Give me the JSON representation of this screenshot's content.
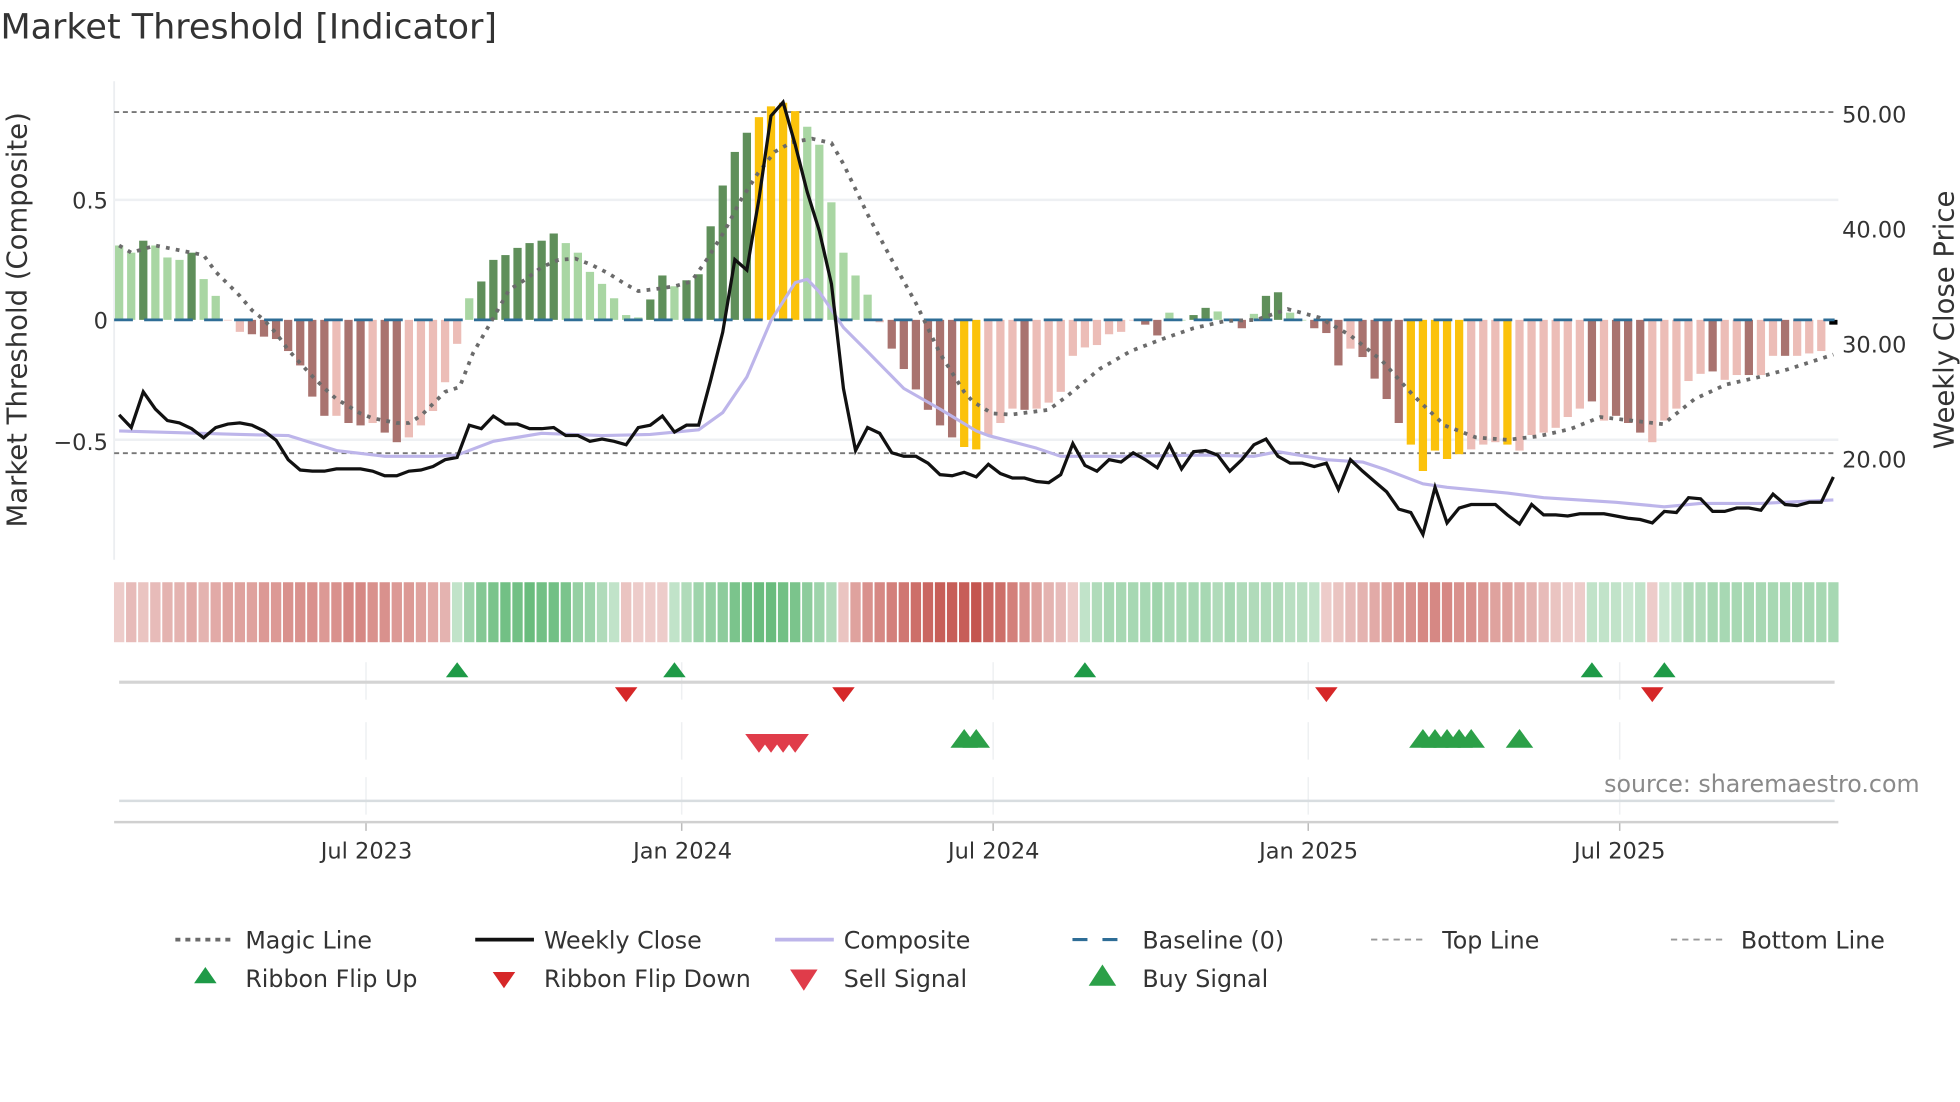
{
  "chart_data": {
    "type": "bar",
    "title": "Market Threshold [Indicator]",
    "ylabel_left": "Market Threshold (Composite)",
    "ylabel_right": "Weekly Close Price",
    "source": "source: sharemaestro.com",
    "x_unit": "week index (weekly bars)",
    "x_range": [
      0,
      142
    ],
    "ylim_left": [
      -0.98,
      1.0
    ],
    "ylim_right": [
      10.6,
      53.0
    ],
    "grid": true,
    "legend_position": "bottom",
    "left_ticks": [
      {
        "v": 0.5,
        "label": "0.5"
      },
      {
        "v": 0,
        "label": "0"
      },
      {
        "v": -0.5,
        "label": "−0.5"
      }
    ],
    "right_ticks": [
      {
        "v": 50,
        "label": "50.00"
      },
      {
        "v": 40,
        "label": "40.00"
      },
      {
        "v": 30,
        "label": "30.00"
      },
      {
        "v": 20,
        "label": "20.00"
      }
    ],
    "x_ticks": [
      {
        "v": 20.45,
        "label": "Jul 2023"
      },
      {
        "v": 46.6,
        "label": "Jan 2024"
      },
      {
        "v": 72.4,
        "label": "Jul 2024"
      },
      {
        "v": 98.5,
        "label": "Jan 2025"
      },
      {
        "v": 124.3,
        "label": "Jul 2025"
      }
    ],
    "top_line": 0.866,
    "bottom_line": -0.556,
    "baseline": 0,
    "colors": {
      "L": "#a9d6a3",
      "G": "#5f8f5a",
      "Y": "#fbc20b",
      "P": "#ecbdb7",
      "R": "#a9736f",
      "magic": "#6b6b6b",
      "close": "#111111",
      "composite": "#bdb5ea",
      "baseline": "#2e6d96",
      "flip_up": "#1e9a47",
      "flip_down": "#d62728",
      "sell": "#e03c4a",
      "buy": "#2ca048",
      "ribbon_red": "#c4554f",
      "ribbon_green": "#4fb066"
    },
    "composite_bars": {
      "values": [
        0.31,
        0.28,
        0.33,
        0.31,
        0.26,
        0.25,
        0.28,
        0.17,
        0.1,
        0,
        -0.05,
        -0.06,
        -0.07,
        -0.08,
        -0.13,
        -0.19,
        -0.32,
        -0.4,
        -0.4,
        -0.43,
        -0.44,
        -0.43,
        -0.47,
        -0.51,
        -0.49,
        -0.44,
        -0.38,
        -0.26,
        -0.1,
        0.09,
        0.16,
        0.25,
        0.27,
        0.3,
        0.32,
        0.33,
        0.36,
        0.32,
        0.28,
        0.2,
        0.15,
        0.09,
        0.02,
        0.01,
        0.085,
        0.185,
        0.14,
        0.165,
        0.19,
        0.39,
        0.56,
        0.7,
        0.78,
        0.845,
        0.89,
        0.905,
        0.87,
        0.805,
        0.73,
        0.49,
        0.28,
        0.185,
        0.105,
        -0.01,
        -0.12,
        -0.205,
        -0.29,
        -0.375,
        -0.44,
        -0.49,
        -0.53,
        -0.54,
        -0.48,
        -0.43,
        -0.37,
        -0.375,
        -0.37,
        -0.345,
        -0.3,
        -0.15,
        -0.115,
        -0.105,
        -0.06,
        -0.05,
        0,
        -0.02,
        -0.065,
        0.03,
        0,
        0.02,
        0.05,
        0.035,
        0,
        -0.035,
        0.025,
        0.1,
        0.115,
        0.03,
        0,
        -0.035,
        -0.055,
        -0.19,
        -0.12,
        -0.155,
        -0.245,
        -0.33,
        -0.43,
        -0.52,
        -0.63,
        -0.545,
        -0.58,
        -0.56,
        -0.54,
        -0.52,
        -0.51,
        -0.52,
        -0.545,
        -0.48,
        -0.47,
        -0.45,
        -0.405,
        -0.37,
        -0.34,
        -0.42,
        -0.4,
        -0.43,
        -0.47,
        -0.51,
        -0.42,
        -0.37,
        -0.255,
        -0.225,
        -0.215,
        -0.25,
        -0.23,
        -0.23,
        -0.23,
        -0.15,
        -0.15,
        -0.15,
        -0.14,
        -0.13,
        -0.02
      ],
      "color_codes": "LLGLLLGLLPPRRRRRRRPRRPRRPPPPPLGGGGGGGLLLLLLLGGLGGGGGGYYYYLLLLLLPRRRRRRYYPPPRPPPPPPPPPRRLLGGLLRLGGLLRRRPRRRRYYYYYPPPYPPPPPPRPRRRPPPPPRPPRPPRPPP"
    },
    "weekly_close": [
      23.8,
      22.7,
      25.8,
      24.3,
      23.3,
      23.1,
      22.6,
      21.8,
      22.7,
      23.0,
      23.1,
      22.9,
      22.4,
      21.6,
      19.9,
      19.0,
      18.9,
      18.9,
      19.1,
      19.1,
      19.1,
      18.9,
      18.5,
      18.5,
      18.9,
      19.0,
      19.3,
      19.9,
      20.1,
      22.9,
      22.6,
      23.7,
      23.0,
      23.0,
      22.6,
      22.6,
      22.7,
      22.0,
      22.0,
      21.5,
      21.7,
      21.5,
      21.2,
      22.7,
      22.9,
      23.7,
      22.3,
      22.9,
      22.9,
      26.8,
      31.0,
      37.3,
      36.4,
      42.6,
      49.8,
      51.0,
      47.3,
      43.2,
      39.8,
      35.2,
      26.1,
      20.7,
      22.7,
      22.2,
      20.5,
      20.2,
      20.2,
      19.6,
      18.6,
      18.5,
      18.8,
      18.4,
      19.5,
      18.7,
      18.3,
      18.3,
      18.0,
      17.9,
      18.6,
      21.3,
      19.4,
      18.9,
      19.9,
      19.7,
      20.5,
      19.9,
      19.2,
      21.2,
      19.1,
      20.6,
      20.7,
      20.3,
      18.9,
      19.9,
      21.2,
      21.7,
      20.2,
      19.6,
      19.6,
      19.3,
      19.6,
      17.3,
      19.9,
      18.9,
      18.0,
      17.1,
      15.6,
      15.3,
      13.4,
      17.5,
      14.4,
      15.7,
      16.0,
      16.0,
      16.0,
      15.1,
      14.3,
      16.0,
      15.1,
      15.1,
      15.0,
      15.2,
      15.2,
      15.2,
      15.0,
      14.8,
      14.7,
      14.4,
      15.4,
      15.3,
      16.6,
      16.5,
      15.4,
      15.4,
      15.7,
      15.7,
      15.5,
      16.9,
      16.0,
      15.9,
      16.2,
      16.2,
      18.4
    ],
    "composite_line": [
      [
        0,
        22.4
      ],
      [
        10,
        22.1
      ],
      [
        14,
        22.0
      ],
      [
        18,
        20.7
      ],
      [
        22,
        20.2
      ],
      [
        26,
        20.2
      ],
      [
        28,
        20.3
      ],
      [
        31,
        21.5
      ],
      [
        35,
        22.2
      ],
      [
        40,
        22.0
      ],
      [
        44,
        22.1
      ],
      [
        48,
        22.5
      ],
      [
        50,
        24.0
      ],
      [
        52,
        27.1
      ],
      [
        54,
        32.0
      ],
      [
        56,
        35.3
      ],
      [
        57,
        35.6
      ],
      [
        58,
        34.5
      ],
      [
        60,
        31.4
      ],
      [
        62,
        29.3
      ],
      [
        65,
        26.1
      ],
      [
        68,
        24.3
      ],
      [
        71,
        22.4
      ],
      [
        72,
        22.0
      ],
      [
        76,
        20.9
      ],
      [
        78,
        20.2
      ],
      [
        84,
        20.2
      ],
      [
        90,
        20.3
      ],
      [
        94,
        20.2
      ],
      [
        96,
        20.6
      ],
      [
        100,
        19.9
      ],
      [
        103,
        19.7
      ],
      [
        105,
        19.0
      ],
      [
        108,
        17.8
      ],
      [
        110,
        17.5
      ],
      [
        115,
        17.0
      ],
      [
        118,
        16.6
      ],
      [
        124,
        16.2
      ],
      [
        128,
        15.8
      ],
      [
        131,
        16.1
      ],
      [
        136,
        16.1
      ],
      [
        142,
        16.4
      ]
    ],
    "magic_line": [
      [
        0,
        0.31
      ],
      [
        1,
        0.28
      ],
      [
        3,
        0.31
      ],
      [
        5,
        0.29
      ],
      [
        7,
        0.27
      ],
      [
        8,
        0.2
      ],
      [
        9,
        0.15
      ],
      [
        10,
        0.1
      ],
      [
        11,
        0.04
      ],
      [
        12,
        0
      ],
      [
        13,
        -0.055
      ],
      [
        14,
        -0.125
      ],
      [
        15,
        -0.18
      ],
      [
        16,
        -0.235
      ],
      [
        17,
        -0.285
      ],
      [
        18,
        -0.33
      ],
      [
        19,
        -0.36
      ],
      [
        20,
        -0.39
      ],
      [
        21,
        -0.41
      ],
      [
        22,
        -0.42
      ],
      [
        23,
        -0.43
      ],
      [
        24,
        -0.43
      ],
      [
        25,
        -0.4
      ],
      [
        26,
        -0.35
      ],
      [
        27,
        -0.3
      ],
      [
        28.2,
        -0.28
      ],
      [
        29.3,
        -0.14
      ],
      [
        30.9,
        0
      ],
      [
        32.3,
        0.125
      ],
      [
        33.7,
        0.17
      ],
      [
        35,
        0.22
      ],
      [
        36.4,
        0.25
      ],
      [
        37.8,
        0.255
      ],
      [
        39.1,
        0.23
      ],
      [
        40.5,
        0.195
      ],
      [
        41.9,
        0.15
      ],
      [
        43,
        0.12
      ],
      [
        44.7,
        0.13
      ],
      [
        46,
        0.14
      ],
      [
        47.4,
        0.16
      ],
      [
        48.8,
        0.26
      ],
      [
        50.2,
        0.375
      ],
      [
        51.5,
        0.5
      ],
      [
        52.9,
        0.61
      ],
      [
        54.3,
        0.7
      ],
      [
        55.7,
        0.74
      ],
      [
        57.4,
        0.755
      ],
      [
        59,
        0.737
      ],
      [
        60,
        0.65
      ],
      [
        62,
        0.44
      ],
      [
        64,
        0.25
      ],
      [
        66,
        0.07
      ],
      [
        68,
        -0.14
      ],
      [
        70,
        -0.3
      ],
      [
        70.7,
        -0.34
      ],
      [
        72.3,
        -0.39
      ],
      [
        73.9,
        -0.395
      ],
      [
        77,
        -0.375
      ],
      [
        78.6,
        -0.315
      ],
      [
        81.2,
        -0.205
      ],
      [
        83.8,
        -0.13
      ],
      [
        86.4,
        -0.08
      ],
      [
        89,
        -0.035
      ],
      [
        91.6,
        -0.005
      ],
      [
        94.2,
        0
      ],
      [
        96.8,
        0.045
      ],
      [
        99.4,
        0.01
      ],
      [
        102,
        -0.065
      ],
      [
        104.6,
        -0.17
      ],
      [
        107.2,
        -0.315
      ],
      [
        109.8,
        -0.44
      ],
      [
        112.4,
        -0.49
      ],
      [
        115,
        -0.5
      ],
      [
        117.6,
        -0.485
      ],
      [
        120.2,
        -0.455
      ],
      [
        122.7,
        -0.405
      ],
      [
        125.3,
        -0.42
      ],
      [
        127.9,
        -0.435
      ],
      [
        130.5,
        -0.33
      ],
      [
        133.1,
        -0.27
      ],
      [
        135.7,
        -0.24
      ],
      [
        138.3,
        -0.205
      ],
      [
        142,
        -0.145
      ]
    ],
    "ribbon": [
      -0.15,
      -0.25,
      -0.2,
      -0.25,
      -0.3,
      -0.3,
      -0.35,
      -0.3,
      -0.35,
      -0.4,
      -0.4,
      -0.4,
      -0.45,
      -0.45,
      -0.5,
      -0.5,
      -0.5,
      -0.45,
      -0.5,
      -0.55,
      -0.55,
      -0.5,
      -0.5,
      -0.45,
      -0.45,
      -0.4,
      -0.35,
      -0.3,
      0.2,
      0.4,
      0.55,
      0.6,
      0.65,
      0.65,
      0.7,
      0.65,
      0.65,
      0.6,
      0.45,
      0.4,
      0.3,
      0.2,
      -0.2,
      -0.15,
      -0.15,
      -0.15,
      0.2,
      0.3,
      0.4,
      0.45,
      0.5,
      0.6,
      0.65,
      0.7,
      0.7,
      0.65,
      0.6,
      0.5,
      0.4,
      0.3,
      -0.2,
      -0.4,
      -0.5,
      -0.55,
      -0.6,
      -0.65,
      -0.7,
      -0.75,
      -0.8,
      -0.8,
      -0.8,
      -0.85,
      -0.75,
      -0.7,
      -0.6,
      -0.5,
      -0.4,
      -0.3,
      -0.25,
      -0.15,
      0.2,
      0.3,
      0.35,
      0.35,
      0.35,
      0.35,
      0.4,
      0.35,
      0.35,
      0.35,
      0.35,
      0.3,
      0.35,
      0.3,
      0.3,
      0.3,
      0.3,
      0.25,
      0.25,
      0.2,
      -0.15,
      -0.2,
      -0.25,
      -0.3,
      -0.35,
      -0.4,
      -0.45,
      -0.5,
      -0.55,
      -0.55,
      -0.55,
      -0.5,
      -0.5,
      -0.45,
      -0.4,
      -0.4,
      -0.35,
      -0.3,
      -0.25,
      -0.2,
      -0.15,
      -0.15,
      0.2,
      0.2,
      0.2,
      0.15,
      0.2,
      -0.15,
      0.15,
      0.2,
      0.3,
      0.3,
      0.35,
      0.35,
      0.35,
      0.35,
      0.35,
      0.35,
      0.35,
      0.35,
      0.35,
      0.35,
      0.35
    ],
    "ribbon_flip_up": [
      28,
      46,
      80,
      122,
      128
    ],
    "ribbon_flip_down": [
      42,
      60,
      100,
      127
    ],
    "sell_signals": [
      53,
      54,
      55,
      56
    ],
    "buy_signals": [
      70,
      71,
      108,
      109,
      110,
      111,
      112,
      116
    ],
    "legend": [
      "Magic Line",
      "Weekly Close",
      "Composite",
      "Baseline (0)",
      "Top Line",
      "Bottom Line",
      "Ribbon Flip Up",
      "Ribbon Flip Down",
      "Sell Signal",
      "Buy Signal"
    ]
  }
}
